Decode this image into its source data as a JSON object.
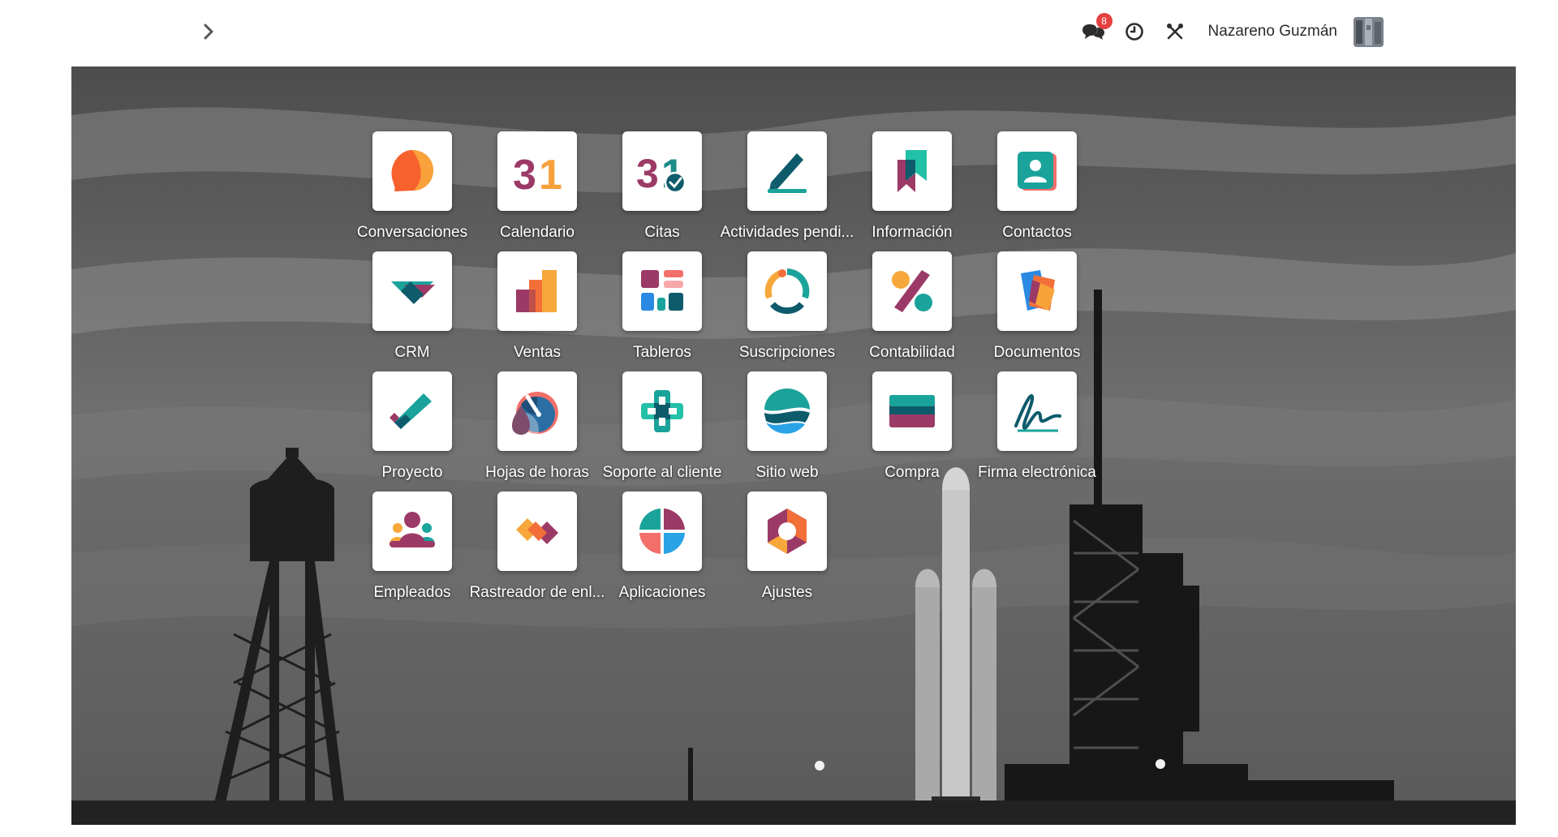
{
  "topbar": {
    "menu_toggle_icon": "chevron-right-icon",
    "messages_icon": "chat-bubbles-icon",
    "messages_badge": "8",
    "activities_icon": "clock-icon",
    "debug_icon": "crossed-tools-icon",
    "user_name": "Nazareno Guzmán",
    "avatar_icon": "user-avatar"
  },
  "apps": [
    {
      "label": "Conversaciones",
      "icon": "discuss-icon"
    },
    {
      "label": "Calendario",
      "icon": "calendar-icon"
    },
    {
      "label": "Citas",
      "icon": "appointments-icon"
    },
    {
      "label": "Actividades pendi...",
      "icon": "activities-pen-icon"
    },
    {
      "label": "Información",
      "icon": "knowledge-bookmark-icon"
    },
    {
      "label": "Contactos",
      "icon": "contacts-card-icon"
    },
    {
      "label": "CRM",
      "icon": "crm-handshake-icon"
    },
    {
      "label": "Ventas",
      "icon": "sales-bars-icon"
    },
    {
      "label": "Tableros",
      "icon": "dashboards-icon"
    },
    {
      "label": "Suscripciones",
      "icon": "subscriptions-circle-icon"
    },
    {
      "label": "Contabilidad",
      "icon": "accounting-percent-icon"
    },
    {
      "label": "Documentos",
      "icon": "documents-icon"
    },
    {
      "label": "Proyecto",
      "icon": "project-check-icon"
    },
    {
      "label": "Hojas de horas",
      "icon": "timesheet-gauge-icon"
    },
    {
      "label": "Soporte al cliente",
      "icon": "helpdesk-cross-icon"
    },
    {
      "label": "Sitio web",
      "icon": "website-waves-icon"
    },
    {
      "label": "Compra",
      "icon": "purchase-card-icon"
    },
    {
      "label": "Firma electrónica",
      "icon": "sign-signature-icon"
    },
    {
      "label": "Empleados",
      "icon": "employees-icon"
    },
    {
      "label": "Rastreador de enl...",
      "icon": "link-tracker-icon"
    },
    {
      "label": "Aplicaciones",
      "icon": "apps-icon"
    },
    {
      "label": "Ajustes",
      "icon": "settings-hexagon-icon"
    }
  ]
}
